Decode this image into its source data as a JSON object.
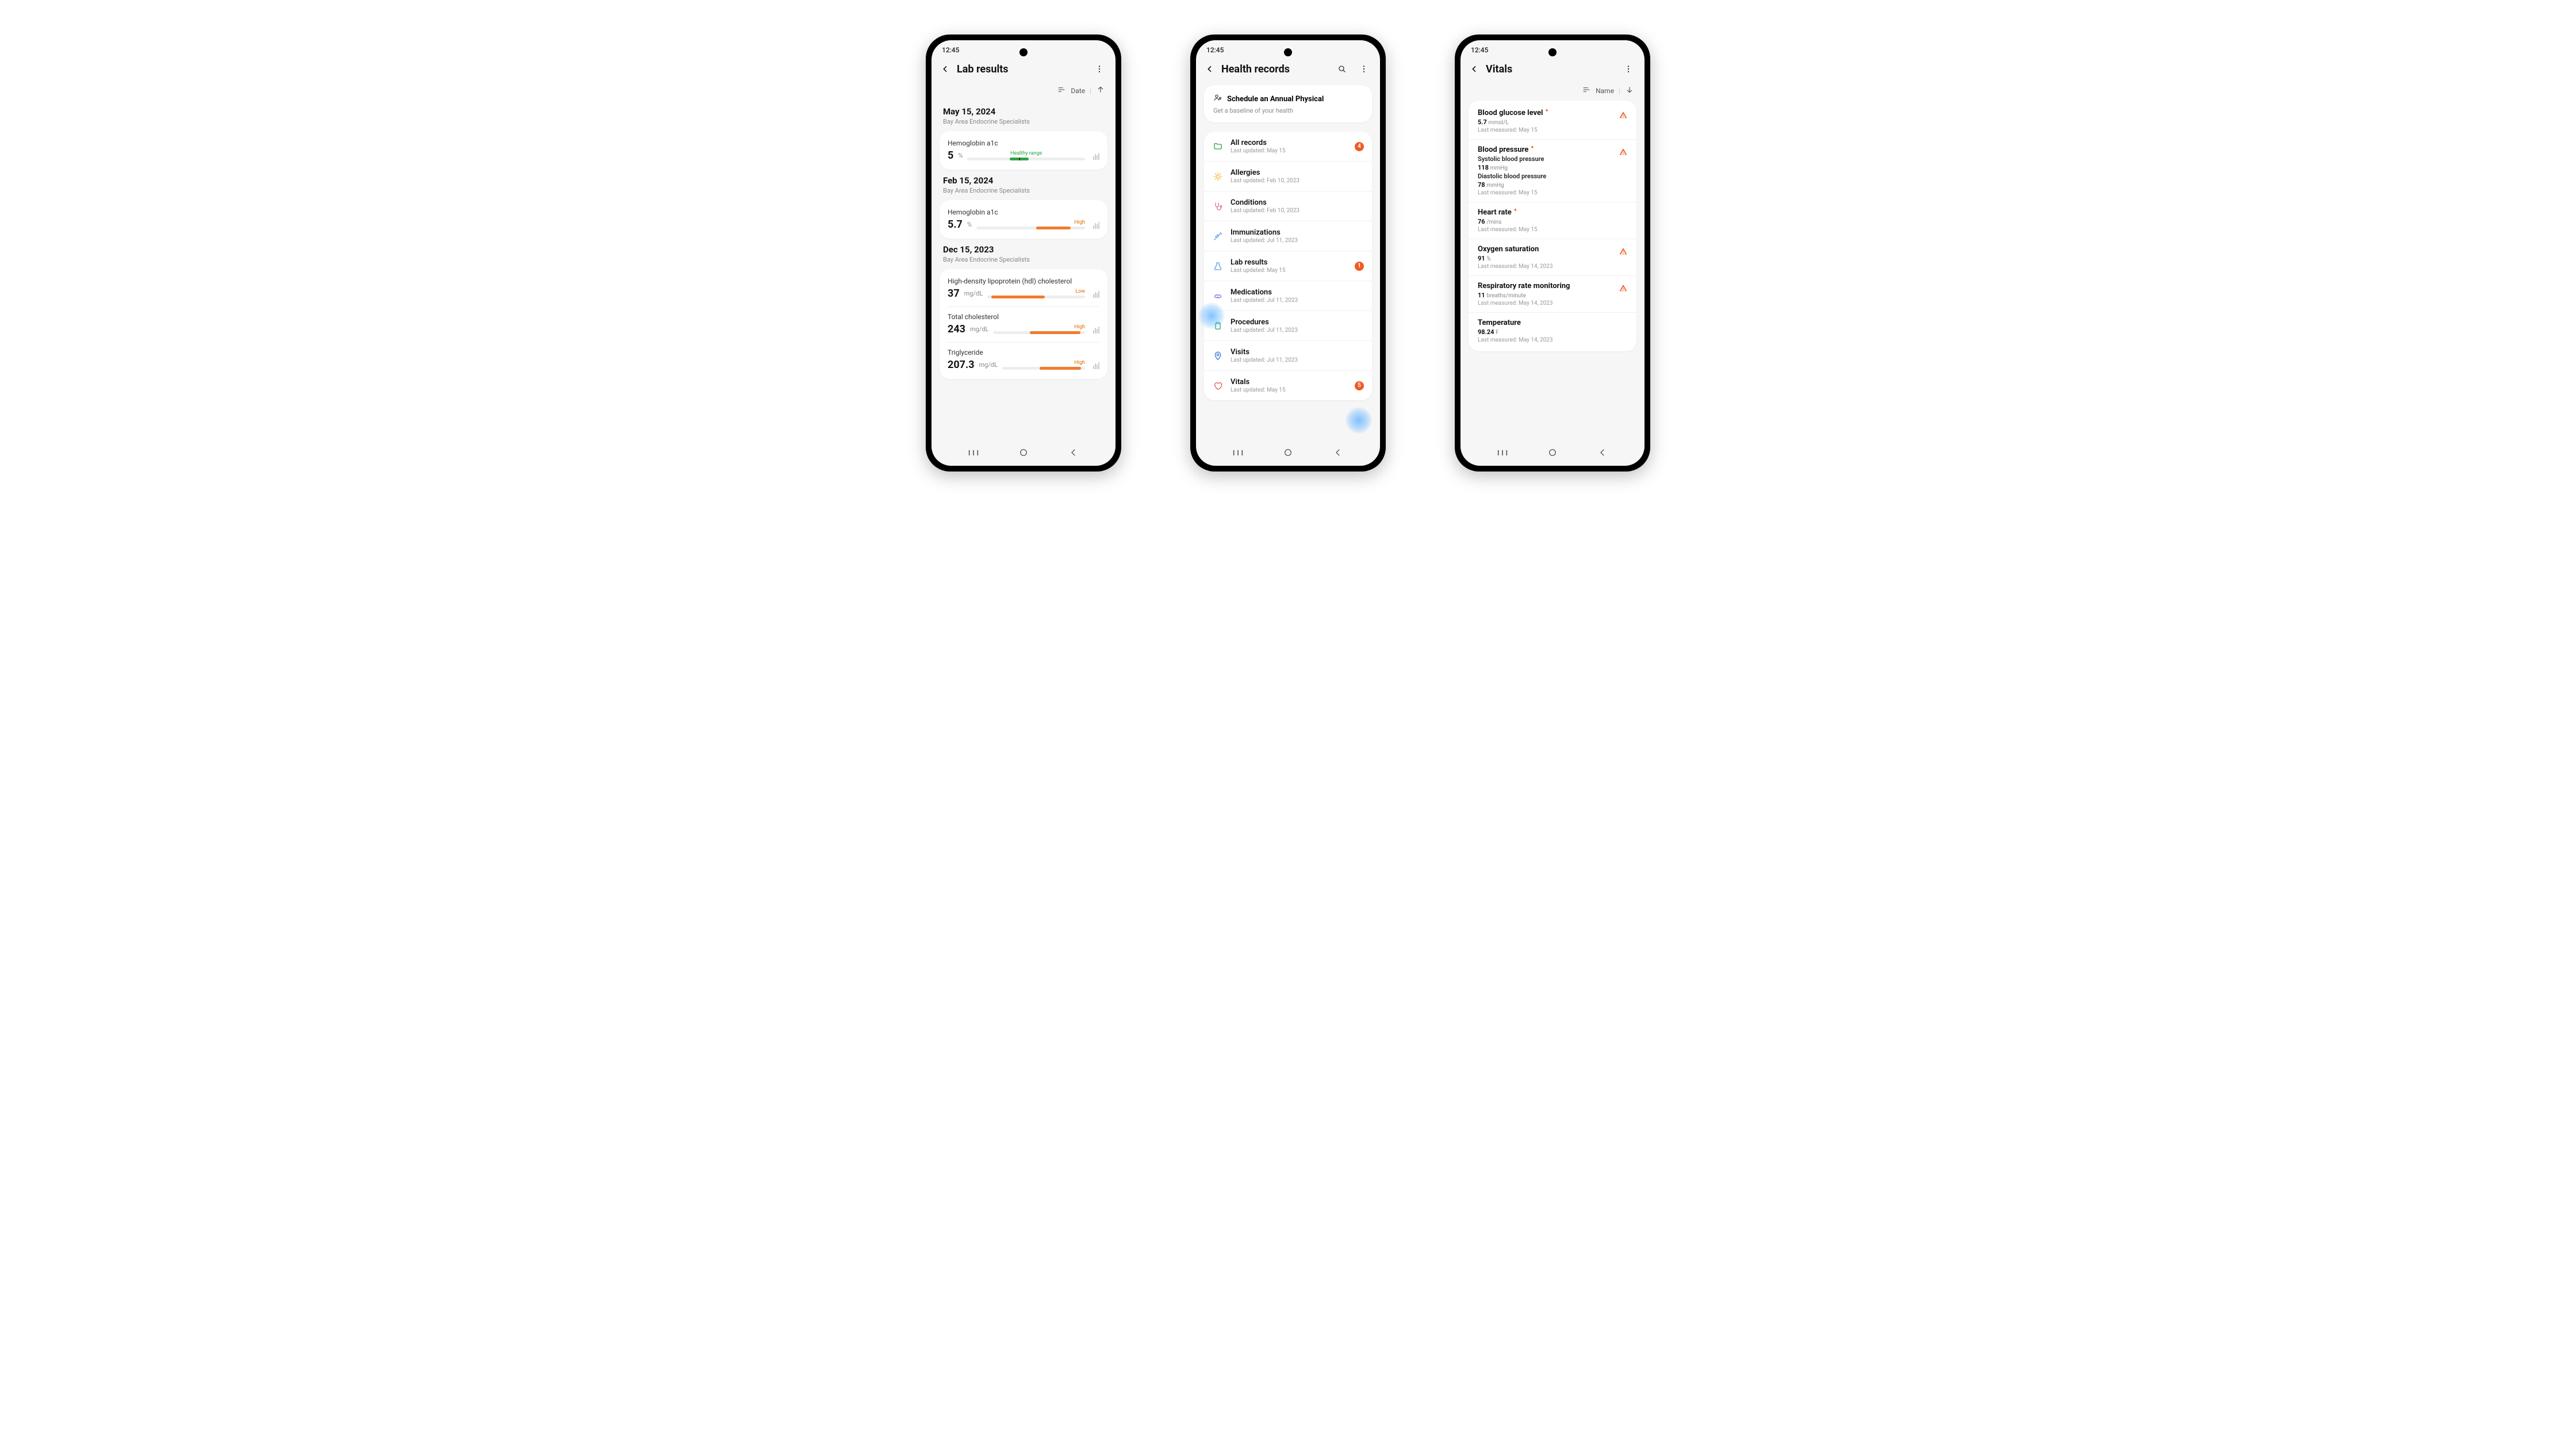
{
  "time": "12:45",
  "phone1": {
    "title": "Lab results",
    "sort": {
      "label": "Date",
      "direction": "asc"
    },
    "groups": [
      {
        "date": "May 15, 2024",
        "provider": "Bay Area Endocrine Specialists",
        "items": [
          {
            "name": "Hemoglobin a1c",
            "value": "5",
            "unit": "%",
            "status": "Healthy range",
            "status_kind": "healthy",
            "fill_start": 36,
            "fill_width": 16
          }
        ]
      },
      {
        "date": "Feb 15, 2024",
        "provider": "Bay Area Endocrine Specialists",
        "items": [
          {
            "name": "Hemoglobin a1c",
            "value": "5.7",
            "unit": "%",
            "status": "High",
            "status_kind": "high",
            "fill_start": 55,
            "fill_width": 32
          }
        ]
      },
      {
        "date": "Dec 15, 2023",
        "provider": "Bay Area Endocrine Specialists",
        "items": [
          {
            "name": "High-density lipoprotein (hdl) cholesterol",
            "value": "37",
            "unit": "mg/dL",
            "status": "Low",
            "status_kind": "low",
            "fill_start": 4,
            "fill_width": 55
          },
          {
            "name": "Total cholesterol",
            "value": "243",
            "unit": "mg/dL",
            "status": "High",
            "status_kind": "high",
            "fill_start": 40,
            "fill_width": 55
          },
          {
            "name": "Triglyceride",
            "value": "207.3",
            "unit": "mg/dL",
            "status": "High",
            "status_kind": "high",
            "fill_start": 45,
            "fill_width": 50
          }
        ]
      }
    ]
  },
  "phone2": {
    "title": "Health records",
    "promo": {
      "title": "Schedule an Annual Physical",
      "sub": "Get a baseline of your health"
    },
    "items": [
      {
        "title": "All records",
        "sub": "Last updated: May 15",
        "icon": "folder-icon",
        "color": "#2aa545",
        "badge": "4"
      },
      {
        "title": "Allergies",
        "sub": "Last updated: Feb 10, 2023",
        "icon": "sun-icon",
        "color": "#f6b73c",
        "badge": ""
      },
      {
        "title": "Conditions",
        "sub": "Last updated: Feb 10, 2023",
        "icon": "stethoscope-icon",
        "color": "#e06aa3",
        "badge": ""
      },
      {
        "title": "Immunizations",
        "sub": "Last updated: Jul 11, 2023",
        "icon": "syringe-icon",
        "color": "#5a9ee0",
        "badge": ""
      },
      {
        "title": "Lab results",
        "sub": "Last updated: May 15",
        "icon": "flask-icon",
        "color": "#5a9ee0",
        "badge": "1"
      },
      {
        "title": "Medications",
        "sub": "Last updated: Jul 11, 2023",
        "icon": "pill-icon",
        "color": "#8a6ad8",
        "badge": ""
      },
      {
        "title": "Procedures",
        "sub": "Last updated: Jul 11, 2023",
        "icon": "clipboard-icon",
        "color": "#2aa58f",
        "badge": ""
      },
      {
        "title": "Visits",
        "sub": "Last updated: Jul 11, 2023",
        "icon": "pin-icon",
        "color": "#3b7ad6",
        "badge": ""
      },
      {
        "title": "Vitals",
        "sub": "Last updated: May 15",
        "icon": "heart-icon",
        "color": "#e05a5a",
        "badge": "5"
      }
    ]
  },
  "phone3": {
    "title": "Vitals",
    "sort": {
      "label": "Name",
      "direction": "desc"
    },
    "items": [
      {
        "title": "Blood glucose level",
        "dot": true,
        "lines": [
          {
            "value": "5.7",
            "unit": "mmol/L"
          }
        ],
        "last": "Last measured: May 15",
        "warn": true
      },
      {
        "title": "Blood pressure",
        "dot": true,
        "lines": [
          {
            "label": "Systolic blood pressure",
            "value": "118",
            "unit": "mmHg"
          },
          {
            "label": "Diastolic blood pressure",
            "value": "78",
            "unit": "mmHg"
          }
        ],
        "last": "Last measured: May 15",
        "warn": true
      },
      {
        "title": "Heart rate",
        "dot": true,
        "lines": [
          {
            "value": "76",
            "unit": "/mins"
          }
        ],
        "last": "Last measured: May 15",
        "warn": false
      },
      {
        "title": "Oxygen saturation",
        "dot": false,
        "lines": [
          {
            "value": "91",
            "unit": "%"
          }
        ],
        "last": "Last measured: May 14, 2023",
        "warn": true
      },
      {
        "title": "Respiratory rate monitoring",
        "dot": false,
        "lines": [
          {
            "value": "11",
            "unit": "breaths/minute"
          }
        ],
        "last": "Last measured: May 14, 2023",
        "warn": true
      },
      {
        "title": "Temperature",
        "dot": false,
        "lines": [
          {
            "value": "98.24",
            "unit": "F"
          }
        ],
        "last": "Last measured: May 14, 2023",
        "warn": false
      }
    ]
  }
}
